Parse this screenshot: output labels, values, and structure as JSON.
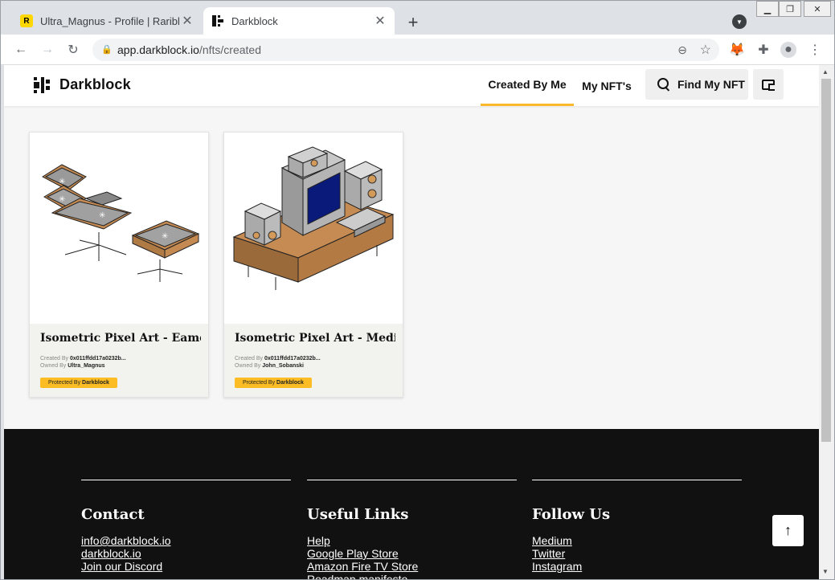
{
  "browser": {
    "tabs": [
      {
        "title": "Ultra_Magnus - Profile | Rarible",
        "favicon": "rarible-icon"
      },
      {
        "title": "Darkblock",
        "favicon": "darkblock-icon"
      }
    ],
    "url_host": "app.darkblock.io",
    "url_path": "/nfts/created"
  },
  "header": {
    "brand": "Darkblock",
    "nav": {
      "created": "Created By Me",
      "mine": "My NFT's"
    },
    "find_label": "Find My NFT"
  },
  "cards": [
    {
      "title": "Isometric Pixel Art - Eame...",
      "created_label": "Created By",
      "creator": "0x011ffdd17a0232b...",
      "owned_label": "Owned By",
      "owner": "Ultra_Magnus",
      "badge_prefix": "Protected By",
      "badge_brand": "Darkblock"
    },
    {
      "title": "Isometric Pixel Art - Media...",
      "created_label": "Created By",
      "creator": "0x011ffdd17a0232b...",
      "owned_label": "Owned By",
      "owner": "John_Sobanski",
      "badge_prefix": "Protected By",
      "badge_brand": "Darkblock"
    }
  ],
  "footer": {
    "contact": {
      "heading": "Contact",
      "links": [
        "info@darkblock.io",
        "darkblock.io",
        "Join our Discord"
      ]
    },
    "useful": {
      "heading": "Useful Links",
      "links": [
        "Help",
        "Google Play Store",
        "Amazon Fire TV Store",
        "Roadmap manifesto"
      ]
    },
    "follow": {
      "heading": "Follow Us",
      "links": [
        "Medium",
        "Twitter",
        "Instagram"
      ]
    }
  },
  "colors": {
    "accent": "#fcb92c",
    "footer_bg": "#111111"
  }
}
